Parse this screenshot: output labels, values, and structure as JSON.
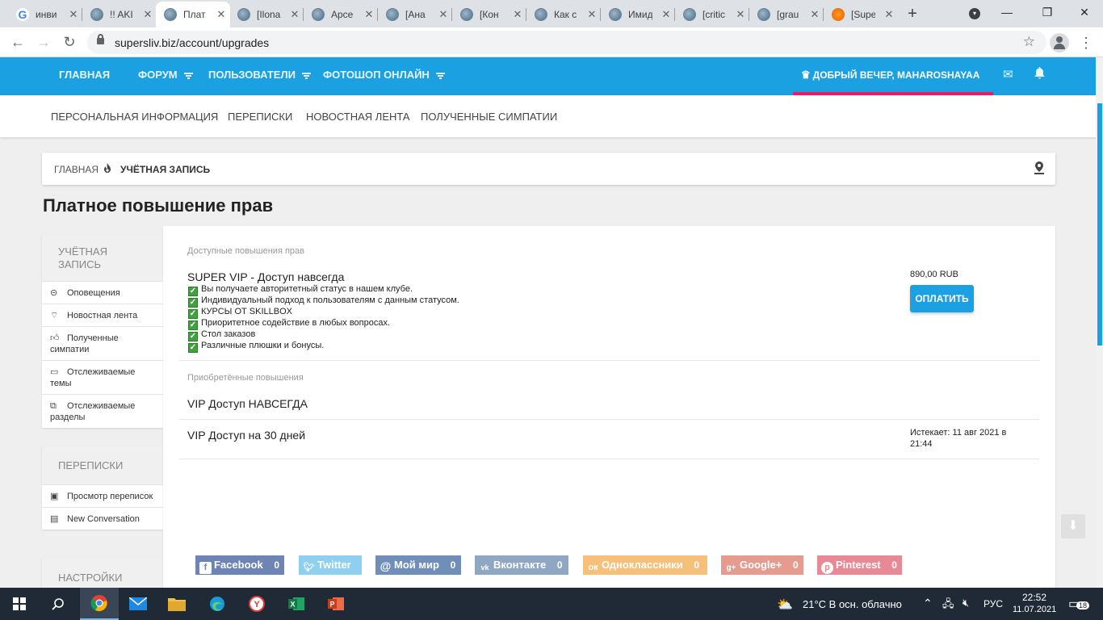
{
  "browser": {
    "tabs": [
      {
        "label": "инви",
        "favicon": "google-icon"
      },
      {
        "label": "!! AKI",
        "favicon": "site-icon"
      },
      {
        "label": "Плат",
        "favicon": "site-icon",
        "active": true
      },
      {
        "label": "[Ilona",
        "favicon": "site-icon"
      },
      {
        "label": "Арсе",
        "favicon": "site-icon"
      },
      {
        "label": "[Ана",
        "favicon": "site-icon"
      },
      {
        "label": "[Кон",
        "favicon": "site-icon"
      },
      {
        "label": "Как с",
        "favicon": "site-icon"
      },
      {
        "label": "Имид",
        "favicon": "site-icon"
      },
      {
        "label": "[critic",
        "favicon": "site-icon"
      },
      {
        "label": "[grau",
        "favicon": "site-icon"
      },
      {
        "label": "[Supe",
        "favicon": "cloud-icon"
      }
    ],
    "url": "supersliv.biz/account/upgrades"
  },
  "header": {
    "nav": [
      "ГЛАВНАЯ",
      "ФОРУМ",
      "ПОЛЬЗОВАТЕЛИ",
      "ФОТОШОП ОНЛАЙН"
    ],
    "greeting": "ДОБРЫЙ ВЕЧЕР, MAHAROSHAYAA",
    "accent_color": "#1ba1e2",
    "highlight_color": "#e91e63"
  },
  "subnav": [
    "ПЕРСОНАЛЬНАЯ ИНФОРМАЦИЯ",
    "ПЕРЕПИСКИ",
    "НОВОСТНАЯ ЛЕНТА",
    "ПОЛУЧЕННЫЕ СИМПАТИИ"
  ],
  "breadcrumb": {
    "home": "ГЛАВНАЯ",
    "current": "УЧЁТНАЯ ЗАПИСЬ"
  },
  "page_title": "Платное повышение прав",
  "sidebar": {
    "account": {
      "title": "УЧЁТНАЯ ЗАПИСЬ",
      "items": [
        {
          "label": "Оповещения",
          "icon": "minus-circle-icon"
        },
        {
          "label": "Новостная лента",
          "icon": "rss-icon"
        },
        {
          "label": "Полученные симпатии",
          "icon": "thumbs-up-icon"
        },
        {
          "label": "Отслеживаемые темы",
          "icon": "comment-icon"
        },
        {
          "label": "Отслеживаемые разделы",
          "icon": "comments-icon"
        }
      ]
    },
    "conversations": {
      "title": "ПЕРЕПИСКИ",
      "items": [
        {
          "label": "Просмотр переписок",
          "icon": "inbox-icon"
        },
        {
          "label": "New Conversation",
          "icon": "message-icon"
        }
      ]
    },
    "settings": {
      "title": "НАСТРОЙКИ"
    }
  },
  "upgrades": {
    "available_label": "Доступные повышения прав",
    "title": "SUPER VIP - Доступ навсегда",
    "features": [
      "Вы получаете авторитетный статус в нашем клубе.",
      "Индивидуальный подход к пользователям с данным статусом.",
      "КУРСЫ ОТ SKILLBOX",
      "Приоритетное содействие в любых вопросах.",
      "Стол заказов",
      "Различные плюшки и бонусы."
    ],
    "price": "890,00 RUB",
    "pay_label": "ОПЛАТИТЬ",
    "purchased_label": "Приобретённые повышения",
    "purchased": [
      {
        "title": "VIP Доступ НАВСЕГДА",
        "expires": ""
      },
      {
        "title": "VIP Доступ на 30 дней",
        "expires": "Истекает: 11 авг 2021 в 21:44"
      }
    ]
  },
  "share": [
    {
      "label": "Facebook",
      "count": "0",
      "color": "#6d84b4",
      "icon": "f"
    },
    {
      "label": "Twitter",
      "count": "",
      "color": "#8fd0f0",
      "icon": "t"
    },
    {
      "label": "Мой мир",
      "count": "0",
      "color": "#6f8fb8",
      "icon": "@"
    },
    {
      "label": "Вконтакте",
      "count": "0",
      "color": "#8fa7c2",
      "icon": "vk"
    },
    {
      "label": "Одноклассники",
      "count": "0",
      "color": "#f6c07a",
      "icon": "ok"
    },
    {
      "label": "Google+",
      "count": "0",
      "color": "#e59c8f",
      "icon": "g+"
    },
    {
      "label": "Pinterest",
      "count": "0",
      "color": "#e88a95",
      "icon": "p"
    }
  ],
  "taskbar": {
    "weather": "21°C  В осн. облачно",
    "lang": "РУС",
    "time": "22:52",
    "date": "11.07.2021",
    "notifications": "18"
  }
}
